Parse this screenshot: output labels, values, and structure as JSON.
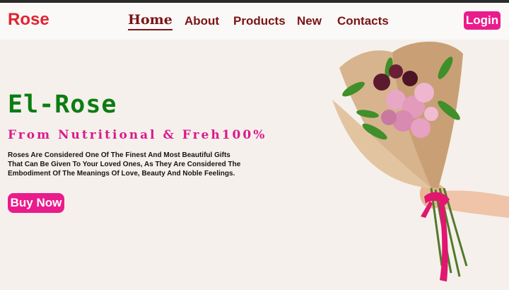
{
  "brand": "Rose",
  "nav": {
    "home": "Home",
    "about": "About",
    "products": "Products",
    "new": "New",
    "contacts": "Contacts",
    "login": "Login"
  },
  "hero": {
    "title": "El-Rose",
    "subtitle": "From Nutritional & Freh100%",
    "description": "Roses Are Considered One Of The Finest And Most Beautiful Gifts That Can Be Given To Your Loved Ones, As They Are Considered The Embodiment Of The Meanings Of Love, Beauty And Noble Feelings.",
    "cta": "Buy Now"
  },
  "colors": {
    "brand": "#e0242f",
    "nav_text": "#7a1414",
    "accent_pink": "#ea1c8c",
    "title_green": "#0b7d12",
    "subtitle_pink": "#d91a8b",
    "background": "#f6f0ec"
  },
  "image": {
    "subject": "hand-holding-flower-bouquet"
  }
}
